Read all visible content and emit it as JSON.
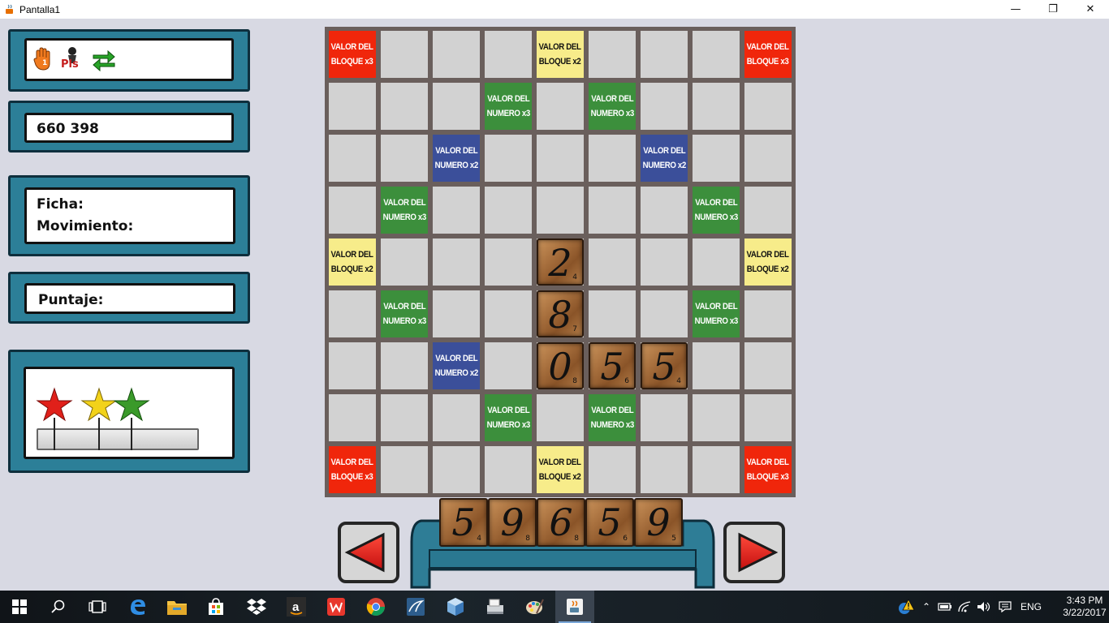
{
  "window": {
    "title": "Pantalla1",
    "minimize": "—",
    "maximize": "❐",
    "close": "✕"
  },
  "panels": {
    "tools": {
      "icons": [
        "hand-number-icon",
        "pass-icon",
        "swap-icon"
      ],
      "pass_label": "Pls"
    },
    "code": {
      "value": "660 398"
    },
    "info": {
      "ficha_label": "Ficha:",
      "movimiento_label": "Movimiento:"
    },
    "score": {
      "label": "Puntaje:"
    },
    "stars": {
      "colors": [
        "#e0201a",
        "#f2d21a",
        "#3a9a2a"
      ]
    }
  },
  "board": {
    "bonus_lines": {
      "valor_del": "VALOR DEL",
      "bloque_x3": "BLOQUE x3",
      "bloque_x2": "BLOQUE x2",
      "numero_x3": "NUMERO x3",
      "numero_x2": "NUMERO x2"
    },
    "tiles": [
      {
        "row": 4,
        "col": 4,
        "digit": "2",
        "points": "4"
      },
      {
        "row": 5,
        "col": 4,
        "digit": "8",
        "points": "7"
      },
      {
        "row": 6,
        "col": 4,
        "digit": "0",
        "points": "8"
      },
      {
        "row": 6,
        "col": 5,
        "digit": "5",
        "points": "6"
      },
      {
        "row": 6,
        "col": 6,
        "digit": "5",
        "points": "4"
      }
    ]
  },
  "rack": {
    "tiles": [
      {
        "digit": "5",
        "points": "4"
      },
      {
        "digit": "9",
        "points": "8"
      },
      {
        "digit": "6",
        "points": "8"
      },
      {
        "digit": "5",
        "points": "6"
      },
      {
        "digit": "9",
        "points": "5"
      }
    ]
  },
  "taskbar": {
    "apps": [
      "start-icon",
      "search-icon",
      "task-view-icon",
      "edge-icon",
      "file-explorer-icon",
      "store-icon",
      "dropbox-icon",
      "amazon-icon",
      "wps-icon",
      "chrome-icon",
      "mysql-workbench-icon",
      "virtualbox-icon",
      "scanner-icon",
      "paint-icon",
      "java-icon"
    ],
    "language": "ENG",
    "time": "3:43 PM",
    "date": "3/22/2017"
  }
}
